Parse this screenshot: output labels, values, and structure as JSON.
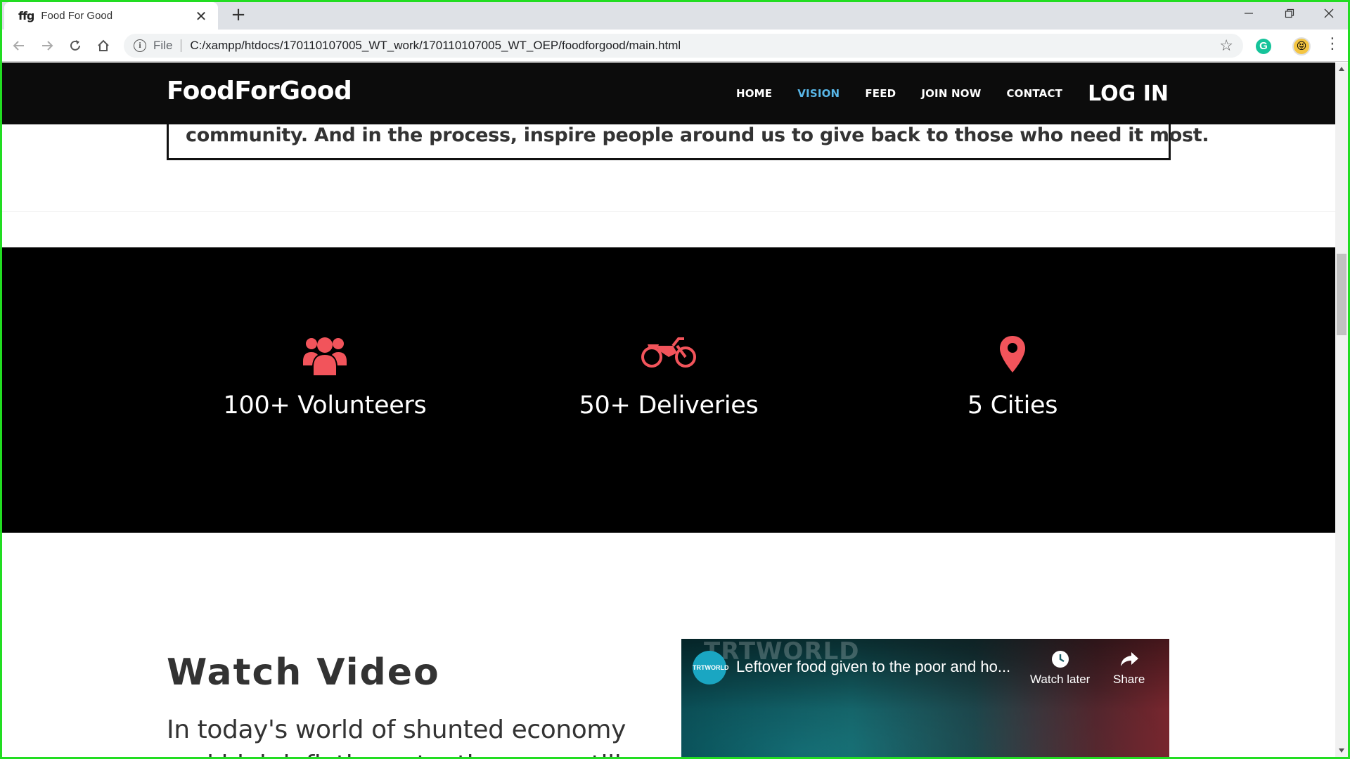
{
  "browser": {
    "tab": {
      "favicon_text": "ffg",
      "title": "Food For Good"
    },
    "address": {
      "scheme_label": "File",
      "url": "C:/xampp/htdocs/170110107005_WT_work/170110107005_WT_OEP/foodforgood/main.html"
    },
    "extension_g": "G"
  },
  "site": {
    "brand": "FoodForGood",
    "nav": {
      "home": "HOME",
      "vision": "VISION",
      "feed": "FEED",
      "join": "JOIN NOW",
      "contact": "CONTACT",
      "login": "LOG IN"
    },
    "mission_line": "community. And in the process, inspire people around us to give back to those who need it most.",
    "stats": [
      {
        "icon": "users-icon",
        "label": "100+ Volunteers"
      },
      {
        "icon": "motorcycle-icon",
        "label": "50+ Deliveries"
      },
      {
        "icon": "map-marker-icon",
        "label": "5 Cities"
      }
    ],
    "accent_color": "#f2545b",
    "watch": {
      "title": "Watch Video",
      "desc": "In today's world of shunted economy and high inflation rate, there are still"
    },
    "video": {
      "watermark": "TRTWORLD",
      "channel": "TRTWORLD",
      "title": "Leftover food given to the poor and ho...",
      "watch_later": "Watch later",
      "share": "Share"
    }
  }
}
